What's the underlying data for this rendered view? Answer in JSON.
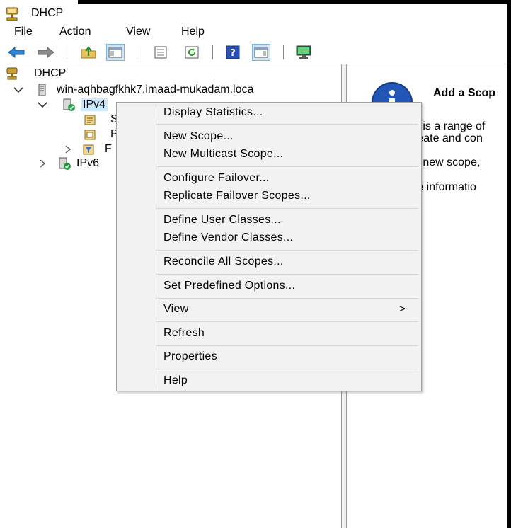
{
  "window": {
    "title": "DHCP"
  },
  "menubar": {
    "items": [
      "File",
      "Action",
      "View",
      "Help"
    ]
  },
  "toolbar": {
    "buttons": [
      "back-icon",
      "forward-icon",
      "up-folder-icon",
      "show-hide-tree-icon",
      "export-list-icon",
      "refresh-icon",
      "help-icon",
      "show-hide-action-pane-icon",
      "monitor-icon"
    ]
  },
  "tree": {
    "root": "DHCP",
    "server": "win-aqhbagfkhk7.imaad-mukadam.loca",
    "ipv4": "IPv4",
    "child1": "S",
    "child2": "P",
    "child3": "F",
    "ipv6": "IPv6"
  },
  "right_pane": {
    "title": "Add a Scop",
    "lines": [
      "e is a range of",
      "reate and con",
      "a new scope,",
      "re informatio"
    ]
  },
  "context_menu": {
    "items": [
      "Display Statistics...",
      "New Scope...",
      "New Multicast Scope...",
      "Configure Failover...",
      "Replicate Failover Scopes...",
      "Define User Classes...",
      "Define Vendor Classes...",
      "Reconcile All Scopes...",
      "Set Predefined Options...",
      "View",
      "Refresh",
      "Properties",
      "Help"
    ],
    "submenu_arrow": ">"
  },
  "colors": {
    "highlight": "#f5f500",
    "selection": "#cce8ff",
    "menu_background": "#f2f2f2"
  }
}
